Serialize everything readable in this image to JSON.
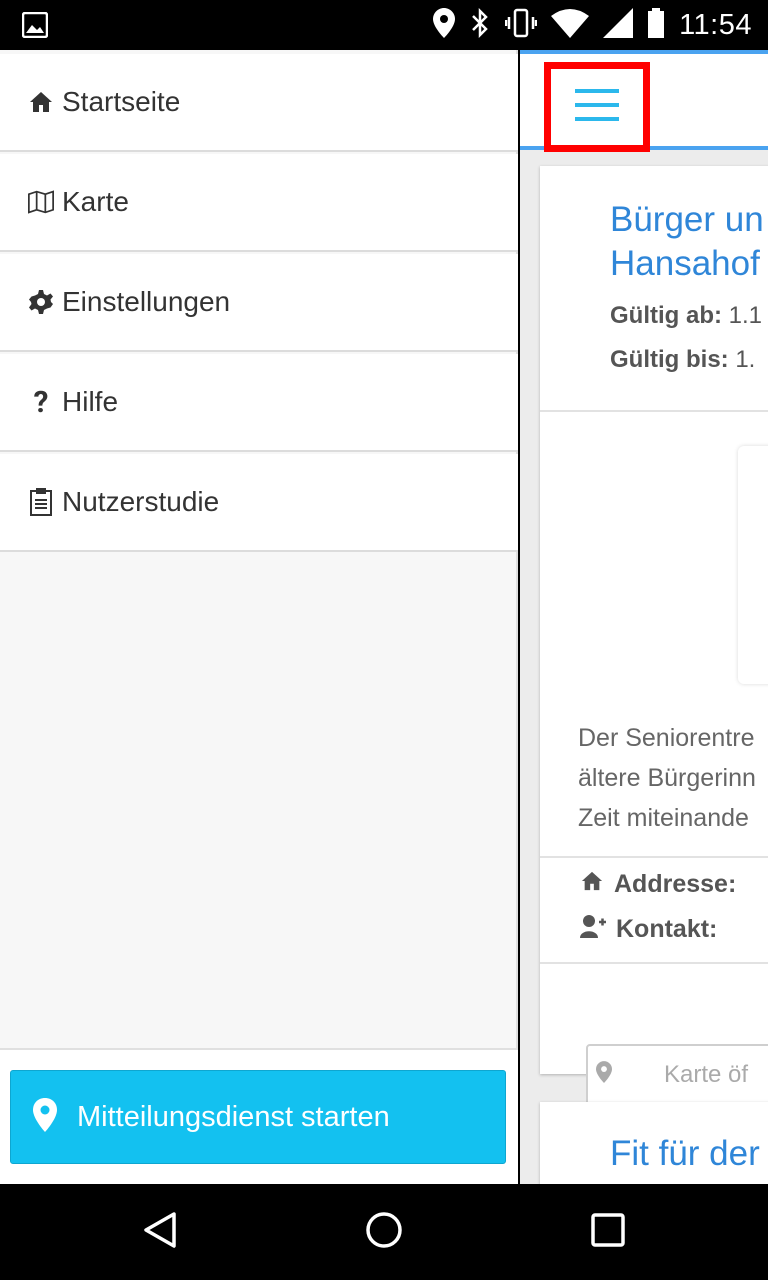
{
  "status_bar": {
    "time": "11:54",
    "icons": [
      "image-icon",
      "location-icon",
      "bluetooth-icon",
      "vibrate-icon",
      "wifi-icon",
      "signal-icon",
      "battery-icon"
    ]
  },
  "drawer": {
    "items": [
      {
        "label": "Startseite",
        "icon": "home-icon"
      },
      {
        "label": "Karte",
        "icon": "map-icon"
      },
      {
        "label": "Einstellungen",
        "icon": "gear-icon"
      },
      {
        "label": "Hilfe",
        "icon": "question-icon"
      },
      {
        "label": "Nutzerstudie",
        "icon": "clipboard-icon"
      }
    ],
    "start_button": {
      "label": "Mitteilungsdienst starten",
      "icon": "location-pin-icon"
    }
  },
  "main": {
    "card1": {
      "title_line1": "Bürger un",
      "title_line2": "Hansahof",
      "valid_from_label": "Gültig ab:",
      "valid_from_value": "1.1",
      "valid_to_label": "Gültig bis:",
      "valid_to_value": "1.",
      "description_lines": [
        "Der Seniorentre",
        "ältere Bürgerinn",
        "Zeit miteinande"
      ],
      "address_label": "Addresse:",
      "contact_label": "Kontakt:",
      "map_placeholder": "Karte öf"
    },
    "card2": {
      "title": "Fit für der"
    }
  },
  "colors": {
    "accent": "#13c1f0",
    "title_blue": "#2f86d8",
    "topbar_line": "#4aa3f0",
    "highlight": "#ff0000"
  },
  "nav_bar": {
    "buttons": [
      "back-icon",
      "home-circle-icon",
      "recents-icon"
    ]
  }
}
